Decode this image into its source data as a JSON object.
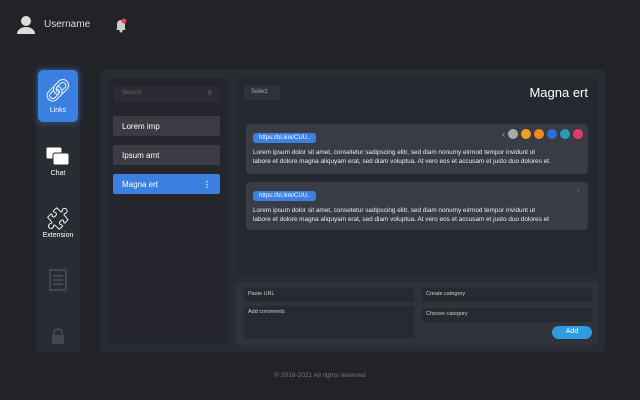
{
  "header": {
    "username": "Username"
  },
  "sidebar": {
    "items": [
      {
        "label": "Links"
      },
      {
        "label": "Chat"
      },
      {
        "label": "Extension"
      }
    ]
  },
  "list": {
    "search_placeholder": "Search",
    "items": [
      "Lorem imp",
      "Ipsum amt",
      "Magna ert"
    ]
  },
  "content": {
    "select_label": "Select",
    "title": "Magna ert",
    "cards": [
      {
        "url": "https://bl.link/CUU..",
        "text1": "Lorem ipsum dolor sit amet, consetetur sadipscing elitr, sed diam nonumy eirmod tempor invidunt ut",
        "text2": "labore et dolore magna aliquyam erat, sed diam voluptua. At vero eos et accusam et justo duo dolores et."
      },
      {
        "url": "https://bl.link/CUU..",
        "text1": "Lorem ipsum dolor sit amet, consetetur sadipscing elitr, sed diam nonumy eirmod tempor invidunt ut",
        "text2": "labore et dolore magna aliquyam erat, sed diam voluptua. At vero eos et accusam et justo duo dolores et"
      }
    ]
  },
  "form": {
    "paste_url": "Paste URL",
    "add_comments": "Add comments",
    "create_category": "Create category",
    "choose_category": "Choose category",
    "add": "Add"
  },
  "footer": "© 2018-2021 All rights reserved",
  "colors": {
    "accent": "#3b7fe0",
    "bg": "#222329"
  }
}
